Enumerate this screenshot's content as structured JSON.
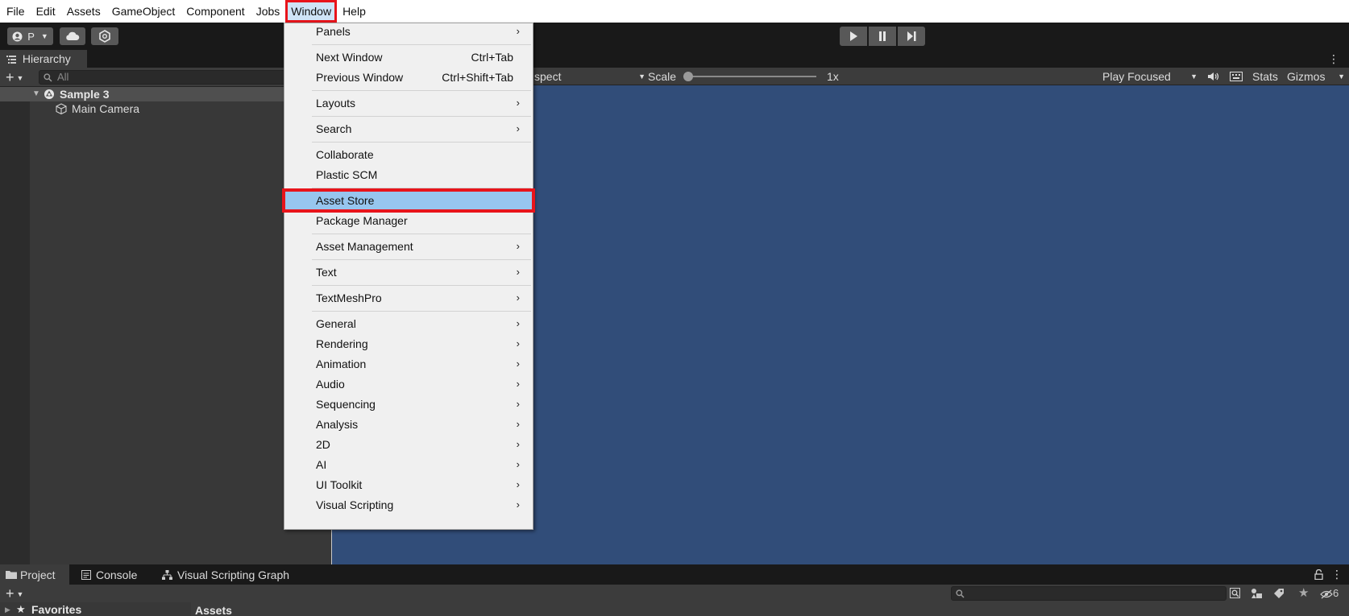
{
  "menubar": {
    "items": [
      "File",
      "Edit",
      "Assets",
      "GameObject",
      "Component",
      "Jobs",
      "Window",
      "Help"
    ]
  },
  "toolbar": {
    "account_label": "P"
  },
  "hierarchy": {
    "tab_label": "Hierarchy",
    "search_placeholder": "All",
    "scene_name": "Sample 3",
    "objects": [
      "Main Camera"
    ]
  },
  "game_view": {
    "aspect_label": "spect",
    "scale_label": "Scale",
    "scale_value": "1x",
    "play_mode": "Play Focused",
    "stats_label": "Stats",
    "gizmos_label": "Gizmos",
    "background_color": "#314d79"
  },
  "bottom": {
    "tabs": [
      "Project",
      "Console",
      "Visual Scripting Graph"
    ],
    "favorites_label": "Favorites",
    "assets_label": "Assets",
    "hidden_count": "6"
  },
  "window_menu": {
    "groups": [
      [
        {
          "label": "Panels",
          "submenu": true
        }
      ],
      [
        {
          "label": "Next Window",
          "shortcut": "Ctrl+Tab"
        },
        {
          "label": "Previous Window",
          "shortcut": "Ctrl+Shift+Tab"
        }
      ],
      [
        {
          "label": "Layouts",
          "submenu": true
        }
      ],
      [
        {
          "label": "Search",
          "submenu": true
        }
      ],
      [
        {
          "label": "Collaborate"
        },
        {
          "label": "Plastic SCM"
        }
      ],
      [
        {
          "label": "Asset Store",
          "highlighted": true
        },
        {
          "label": "Package Manager"
        }
      ],
      [
        {
          "label": "Asset Management",
          "submenu": true
        }
      ],
      [
        {
          "label": "Text",
          "submenu": true
        }
      ],
      [
        {
          "label": "TextMeshPro",
          "submenu": true
        }
      ],
      [
        {
          "label": "General",
          "submenu": true
        },
        {
          "label": "Rendering",
          "submenu": true
        },
        {
          "label": "Animation",
          "submenu": true
        },
        {
          "label": "Audio",
          "submenu": true
        },
        {
          "label": "Sequencing",
          "submenu": true
        },
        {
          "label": "Analysis",
          "submenu": true
        },
        {
          "label": "2D",
          "submenu": true
        },
        {
          "label": "AI",
          "submenu": true
        },
        {
          "label": "UI Toolkit",
          "submenu": true
        },
        {
          "label": "Visual Scripting",
          "submenu": true
        }
      ]
    ]
  },
  "colors": {
    "highlight": "#97c6ef",
    "annotation_red": "#e8141b"
  }
}
